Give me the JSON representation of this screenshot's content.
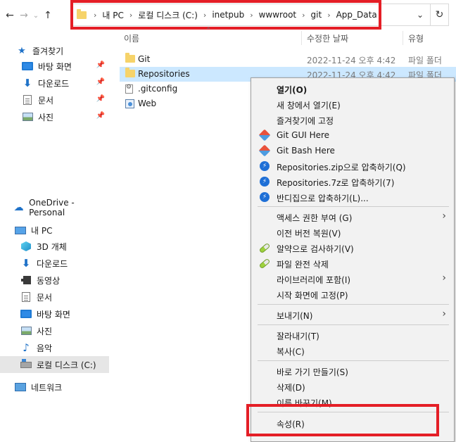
{
  "address_bar": {
    "crumbs": [
      "내 PC",
      "로컬 디스크 (C:)",
      "inetpub",
      "wwwroot",
      "git",
      "App_Data"
    ],
    "highlight_color": "#e41e26"
  },
  "columns": {
    "name": "이름",
    "date_modified": "수정한 날짜",
    "type": "유형"
  },
  "sidebar": {
    "quick_access": "즐겨찾기",
    "quick_items": [
      "바탕 화면",
      "다운로드",
      "문서",
      "사진"
    ],
    "onedrive": "OneDrive - Personal",
    "this_pc": "내 PC",
    "pc_items": [
      "3D 개체",
      "다운로드",
      "동영상",
      "문서",
      "바탕 화면",
      "사진",
      "음악",
      "로컬 디스크 (C:)"
    ],
    "network": "네트워크"
  },
  "files": [
    {
      "name": "Git",
      "date": "2022-11-24 오후 4:42",
      "type": "파일 폴더"
    },
    {
      "name": "Repositories",
      "date": "2022-11-24 오후 4:42",
      "type": "파일 폴더"
    },
    {
      "name": ".gitconfig",
      "date": "",
      "type": ""
    },
    {
      "name": "Web",
      "date": "",
      "type": ""
    }
  ],
  "context_menu": {
    "items": [
      "열기(O)",
      "새 창에서 열기(E)",
      "즐겨찾기에 고정",
      "Git GUI Here",
      "Git Bash Here",
      "Repositories.zip으로 압축하기(Q)",
      "Repositories.7z로 압축하기(7)",
      "반디집으로 압축하기(L)...",
      "액세스 권한 부여 (G)",
      "이전 버전 복원(V)",
      "알약으로 검사하기(V)",
      "파일 완전 삭제",
      "라이브러리에 포함(I)",
      "시작 화면에 고정(P)",
      "보내기(N)",
      "잘라내기(T)",
      "복사(C)",
      "바로 가기 만들기(S)",
      "삭제(D)",
      "이름 바꾸기(M)",
      "속성(R)"
    ]
  },
  "colors": {
    "selection_bg": "#cce8ff",
    "menu_bg": "#f2f2f2",
    "annotation_red": "#e41e26"
  }
}
